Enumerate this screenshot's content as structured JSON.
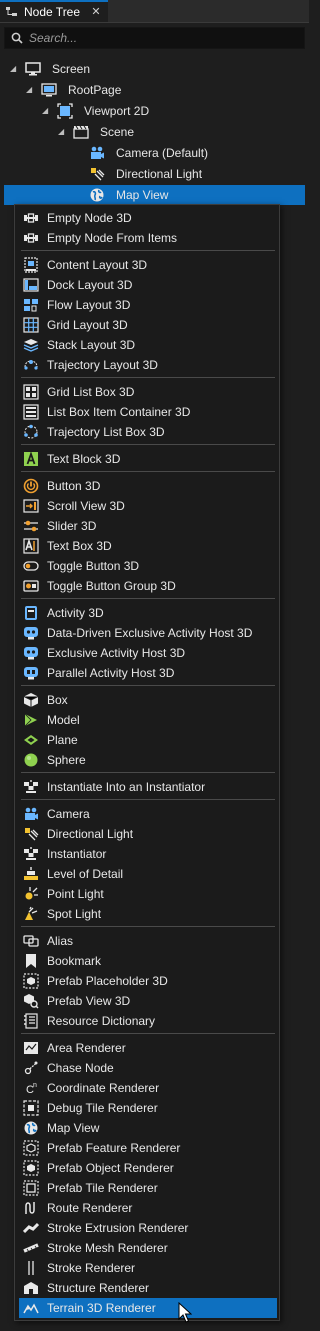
{
  "tab": {
    "title": "Node Tree",
    "close": "✕"
  },
  "search": {
    "placeholder": "Search..."
  },
  "tree": [
    {
      "label": "Screen",
      "icon": "monitor-icon",
      "expanded": true
    },
    {
      "label": "RootPage",
      "icon": "page-icon",
      "expanded": true
    },
    {
      "label": "Viewport 2D",
      "icon": "viewport-icon",
      "expanded": true
    },
    {
      "label": "Scene",
      "icon": "scene-icon",
      "expanded": true
    },
    {
      "label": "Camera (Default)",
      "icon": "camera-icon"
    },
    {
      "label": "Directional Light",
      "icon": "directional-light-icon"
    },
    {
      "label": "Map View",
      "icon": "globe-icon",
      "selected": true
    }
  ],
  "menu": {
    "groups": [
      [
        {
          "label": "Empty Node 3D",
          "icon": "empty-node-icon"
        },
        {
          "label": "Empty Node From Items",
          "icon": "empty-node-icon"
        }
      ],
      [
        {
          "label": "Content Layout 3D",
          "icon": "content-layout-icon"
        },
        {
          "label": "Dock Layout 3D",
          "icon": "dock-layout-icon"
        },
        {
          "label": "Flow Layout 3D",
          "icon": "flow-layout-icon"
        },
        {
          "label": "Grid Layout 3D",
          "icon": "grid-layout-icon"
        },
        {
          "label": "Stack Layout 3D",
          "icon": "stack-layout-icon"
        },
        {
          "label": "Trajectory Layout 3D",
          "icon": "trajectory-layout-icon"
        }
      ],
      [
        {
          "label": "Grid List Box 3D",
          "icon": "grid-list-box-icon"
        },
        {
          "label": "List Box Item Container 3D",
          "icon": "list-box-icon"
        },
        {
          "label": "Trajectory List Box 3D",
          "icon": "trajectory-list-icon"
        }
      ],
      [
        {
          "label": "Text Block 3D",
          "icon": "text-block-icon"
        }
      ],
      [
        {
          "label": "Button 3D",
          "icon": "power-button-icon"
        },
        {
          "label": "Scroll View 3D",
          "icon": "scroll-view-icon"
        },
        {
          "label": "Slider 3D",
          "icon": "slider-icon"
        },
        {
          "label": "Text Box 3D",
          "icon": "text-box-icon"
        },
        {
          "label": "Toggle Button 3D",
          "icon": "toggle-icon"
        },
        {
          "label": "Toggle Button Group 3D",
          "icon": "toggle-group-icon"
        }
      ],
      [
        {
          "label": "Activity 3D",
          "icon": "activity-icon"
        },
        {
          "label": "Data-Driven Exclusive Activity Host 3D",
          "icon": "activity-host-icon"
        },
        {
          "label": "Exclusive Activity Host 3D",
          "icon": "activity-host-icon"
        },
        {
          "label": "Parallel Activity Host 3D",
          "icon": "parallel-host-icon"
        }
      ],
      [
        {
          "label": "Box",
          "icon": "box-icon"
        },
        {
          "label": "Model",
          "icon": "model-icon"
        },
        {
          "label": "Plane",
          "icon": "plane-icon"
        },
        {
          "label": "Sphere",
          "icon": "sphere-icon"
        }
      ],
      [
        {
          "label": "Instantiate Into an Instantiator",
          "icon": "instantiator-icon"
        }
      ],
      [
        {
          "label": "Camera",
          "icon": "camera-icon"
        },
        {
          "label": "Directional Light",
          "icon": "directional-light-icon"
        },
        {
          "label": "Instantiator",
          "icon": "instantiator-icon"
        },
        {
          "label": "Level of Detail",
          "icon": "level-of-detail-icon"
        },
        {
          "label": "Point Light",
          "icon": "point-light-icon"
        },
        {
          "label": "Spot Light",
          "icon": "spot-light-icon"
        }
      ],
      [
        {
          "label": "Alias",
          "icon": "alias-icon"
        },
        {
          "label": "Bookmark",
          "icon": "bookmark-icon"
        },
        {
          "label": "Prefab Placeholder 3D",
          "icon": "prefab-placeholder-icon"
        },
        {
          "label": "Prefab View 3D",
          "icon": "prefab-view-icon"
        },
        {
          "label": "Resource Dictionary",
          "icon": "resource-dictionary-icon"
        }
      ],
      [
        {
          "label": "Area Renderer",
          "icon": "area-renderer-icon"
        },
        {
          "label": "Chase Node",
          "icon": "chase-node-icon"
        },
        {
          "label": "Coordinate Renderer",
          "icon": "coordinate-icon"
        },
        {
          "label": "Debug Tile Renderer",
          "icon": "debug-tile-icon"
        },
        {
          "label": "Map View",
          "icon": "globe-icon"
        },
        {
          "label": "Prefab Feature Renderer",
          "icon": "prefab-feature-icon"
        },
        {
          "label": "Prefab Object Renderer",
          "icon": "prefab-object-icon"
        },
        {
          "label": "Prefab Tile Renderer",
          "icon": "prefab-tile-icon"
        },
        {
          "label": "Route Renderer",
          "icon": "route-icon"
        },
        {
          "label": "Stroke Extrusion Renderer",
          "icon": "stroke-extrusion-icon"
        },
        {
          "label": "Stroke Mesh Renderer",
          "icon": "stroke-mesh-icon"
        },
        {
          "label": "Stroke Renderer",
          "icon": "stroke-icon"
        },
        {
          "label": "Structure Renderer",
          "icon": "structure-icon"
        },
        {
          "label": "Terrain 3D Renderer",
          "icon": "terrain-icon",
          "highlighted": true
        }
      ]
    ]
  },
  "colors": {
    "accent": "#0e70c0",
    "panel": "#1e1e1e",
    "menu": "#1b1b1b"
  }
}
